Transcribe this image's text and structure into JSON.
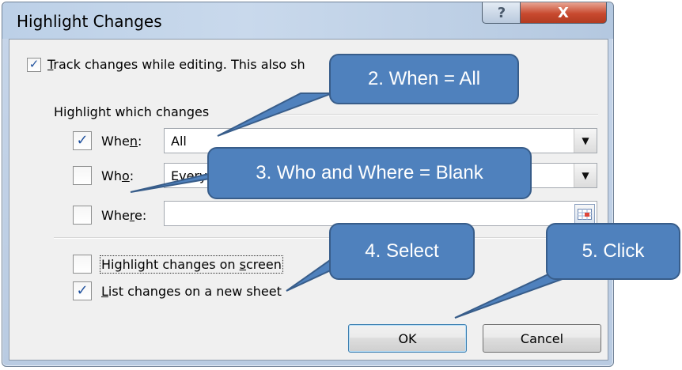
{
  "dialog": {
    "title": "Highlight Changes",
    "help_label": "?",
    "close_label": "X",
    "track_label_pre": "",
    "track_label_key": "T",
    "track_label_post": "rack changes while editing. This also sh",
    "track_checked": true,
    "group_label": "Highlight which changes",
    "when": {
      "label_pre": "Whe",
      "label_key": "n",
      "label_post": ":",
      "checked": true,
      "value": "All"
    },
    "who": {
      "label_pre": "Wh",
      "label_key": "o",
      "label_post": ":",
      "checked": false,
      "value": "Every"
    },
    "where": {
      "label_pre": "Whe",
      "label_key": "r",
      "label_post": "e:",
      "checked": false,
      "value": ""
    },
    "highlight_screen": {
      "label_pre": "Highlight changes on ",
      "label_key": "s",
      "label_post": "creen",
      "checked": false
    },
    "list_sheet": {
      "label_pre": "",
      "label_key": "L",
      "label_post": "ist changes on a new sheet",
      "checked": true
    },
    "ok_label": "OK",
    "cancel_label": "Cancel"
  },
  "callouts": {
    "when_all": "2. When = All",
    "who_where_blank": "3. Who and Where = Blank",
    "select": "4. Select",
    "click": "5. Click"
  },
  "colors": {
    "callout_fill": "#4f81bd",
    "callout_border": "#385d8a",
    "check_mark": "#21529e"
  }
}
